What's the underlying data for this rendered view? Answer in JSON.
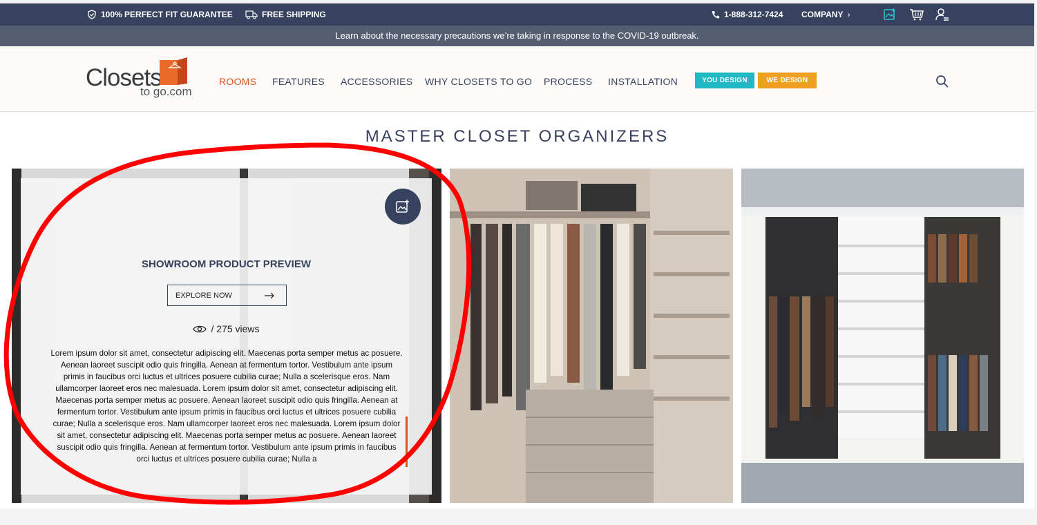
{
  "topbar": {
    "guarantee": "100% PERFECT FIT GUARANTEE",
    "shipping": "FREE SHIPPING",
    "phone": "1-888-312-7424",
    "company": "COMPANY",
    "icons": [
      "add-photo-icon",
      "cart-icon",
      "user-menu-icon"
    ]
  },
  "notice": "Learn about the necessary precautions we’re taking in response to the COVID-19 outbreak.",
  "logo": {
    "word": "Closets",
    "sub": "to go.com"
  },
  "nav": {
    "items": [
      "ROOMS",
      "FEATURES",
      "ACCESSORIES",
      "WHY CLOSETS TO GO",
      "PROCESS",
      "INSTALLATION"
    ],
    "active": "ROOMS",
    "you_design": "YOU DESIGN",
    "we_design": "WE DESIGN"
  },
  "colors": {
    "navy": "#37425e",
    "orange": "#d9531e",
    "teal": "#1fb8c3",
    "amber": "#f0a020",
    "annotation": "#ff0000"
  },
  "page_title": "MASTER CLOSET ORGANIZERS",
  "preview": {
    "title": "SHOWROOM PRODUCT PREVIEW",
    "explore": "EXPLORE NOW",
    "views": "/ 275 views",
    "body": "Lorem ipsum dolor sit amet, consectetur adipiscing elit. Maecenas porta semper metus ac posuere. Aenean laoreet suscipit odio quis fringilla. Aenean at fermentum tortor. Vestibulum ante ipsum primis in faucibus orci luctus et ultrices posuere cubilia curae; Nulla a scelerisque eros. Nam ullamcorper laoreet eros nec malesuada. Lorem ipsum dolor sit amet, consectetur adipiscing elit. Maecenas porta semper metus ac posuere. Aenean laoreet suscipit odio quis fringilla. Aenean at fermentum tortor. Vestibulum ante ipsum primis in faucibus orci luctus et ultrices posuere cubilia curae; Nulla a scelerisque eros. Nam ullamcorper laoreet eros nec malesuada. Lorem ipsum dolor sit amet, consectetur adipiscing elit. Maecenas porta semper metus ac posuere. Aenean laoreet suscipit odio quis fringilla. Aenean at fermentum tortor. Vestibulum ante ipsum primis in faucibus orci luctus et ultrices posuere cubilia curae; Nulla a"
  }
}
